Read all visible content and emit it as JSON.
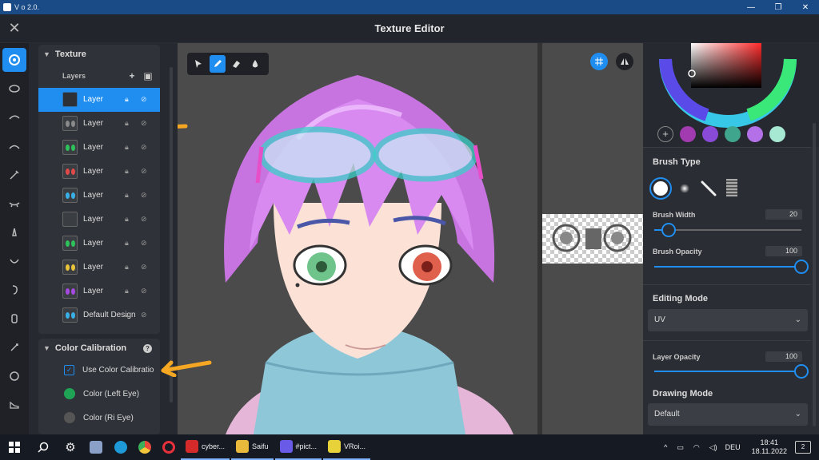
{
  "os": {
    "title": "V         o      2.0.",
    "minimize": "—",
    "maximize": "❐",
    "close": "✕"
  },
  "app": {
    "close": "✕",
    "title": "Texture Editor"
  },
  "texture_panel": {
    "title": "Texture",
    "layers_label": "Layers",
    "add": "+",
    "add_image": "▣",
    "layers": [
      {
        "name": "Layer",
        "eye_color": "",
        "selected": true
      },
      {
        "name": "Layer",
        "eye_color": "#8a8a8a"
      },
      {
        "name": "Layer",
        "eye_color": "#2ec25a"
      },
      {
        "name": "Layer",
        "eye_color": "#e24a4a"
      },
      {
        "name": "Layer",
        "eye_color": "#3ab0e8"
      },
      {
        "name": "Layer",
        "eye_color": ""
      },
      {
        "name": "Layer",
        "eye_color": "#2ec25a"
      },
      {
        "name": "Layer",
        "eye_color": "#e8c43a"
      },
      {
        "name": "Layer",
        "eye_color": "#a64ae2"
      },
      {
        "name": "Default Design",
        "eye_color": "#3ab0e8"
      }
    ]
  },
  "calibration": {
    "title": "Color Calibration",
    "help": "?",
    "use_label": "Use Color Calibratio",
    "use_checked": true,
    "check_mark": "✓",
    "left_eye": "Color (Left Eye)",
    "right_eye": "Color (Ri    Eye)",
    "left_eye_color": "#1fa456"
  },
  "swatches": [
    "#a23bb0",
    "#8a4ad8",
    "#3fa58c",
    "#b470e6",
    "#a6e8d2"
  ],
  "brush": {
    "type_title": "Brush Type",
    "width_label": "Brush Width",
    "width_value": "20",
    "width_fraction": 0.1,
    "opacity_label": "Brush Opacity",
    "opacity_value": "100",
    "opacity_fraction": 1.0
  },
  "editing": {
    "title": "Editing Mode",
    "value": "UV"
  },
  "layer_opacity": {
    "label": "Layer Opacity",
    "value": "100",
    "fraction": 1.0
  },
  "drawing": {
    "title": "Drawing Mode",
    "value": "Default"
  },
  "taskbar": {
    "apps": [
      {
        "label": "cyber...",
        "color": "#d42a2a"
      },
      {
        "label": "Saifu",
        "color": "#e8b93a"
      },
      {
        "label": "#pict...",
        "color": "#6a5ae8"
      },
      {
        "label": "VRoi...",
        "color": "#e8d23a"
      }
    ],
    "lang": "DEU",
    "time": "18:41",
    "date": "18.11.2022",
    "notifications": "2"
  },
  "accent": "#1f8ef0"
}
